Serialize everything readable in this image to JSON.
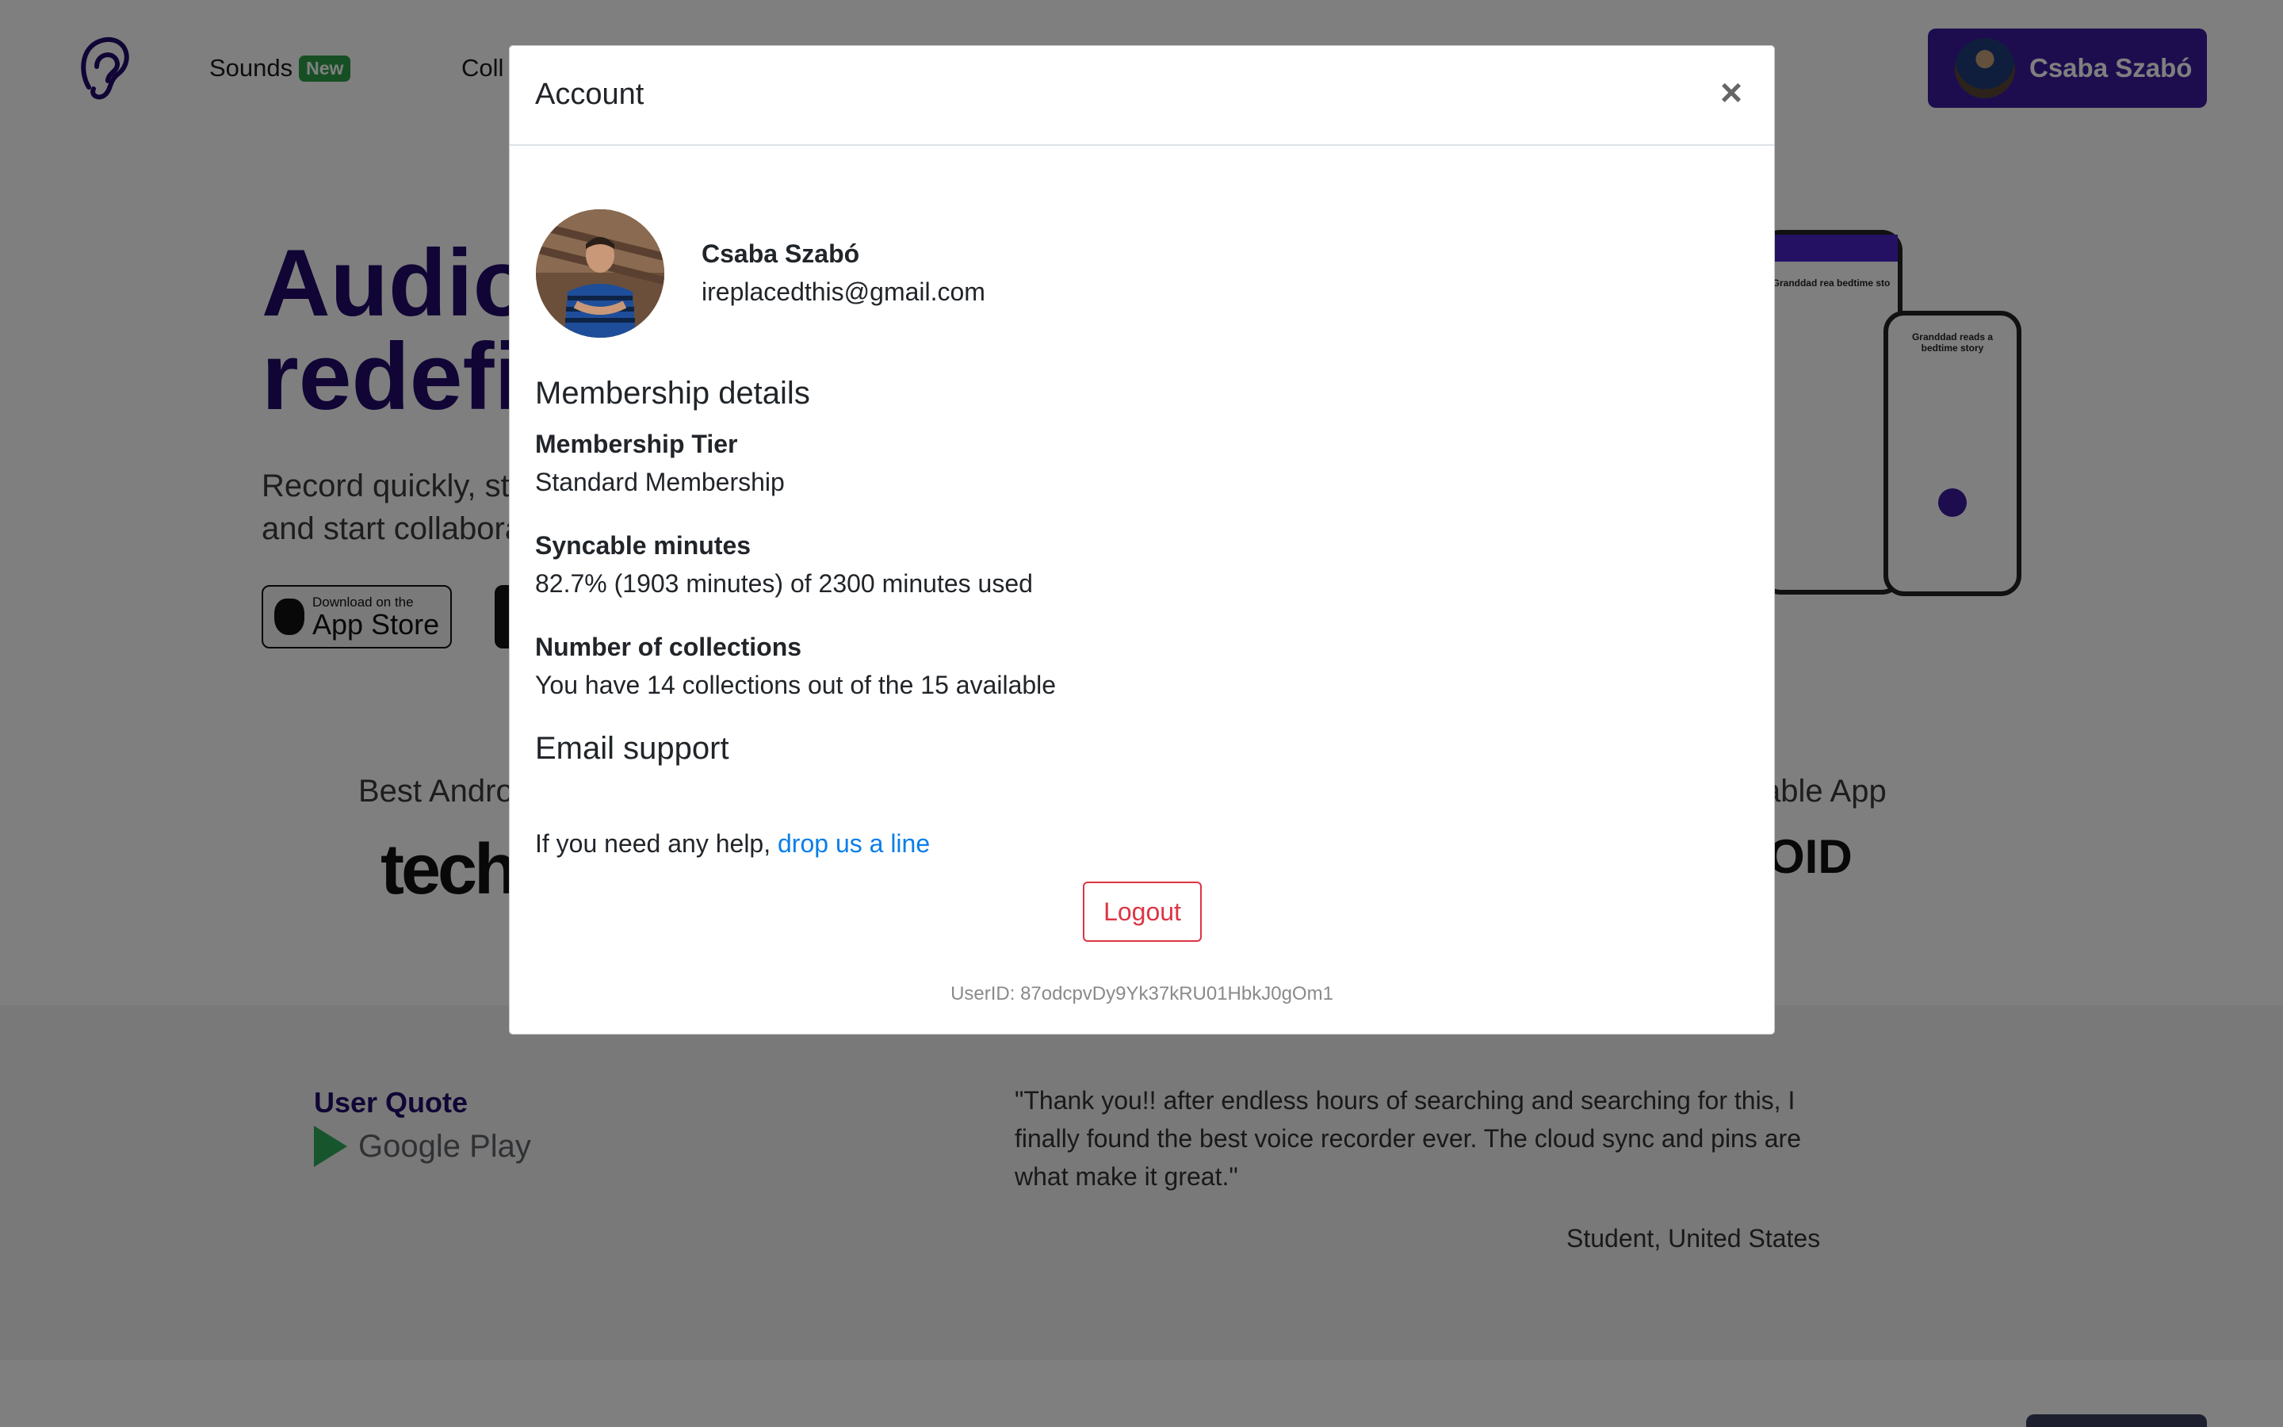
{
  "nav": {
    "links": [
      {
        "label": "Sounds",
        "badge": "New"
      },
      {
        "label": "Coll"
      }
    ],
    "user_name": "Csaba Szabó"
  },
  "hero": {
    "title": "Audio\nredefi",
    "subtitle": "Record quickly, sto\nand start collabora",
    "app_store_small": "Download on the",
    "app_store_big": "App Store"
  },
  "press": {
    "left_text": "Best Andro",
    "right_text": "able App",
    "left_logo": "tech",
    "right_logo": "OID"
  },
  "phones": {
    "tablet_title": "Granddad rea bedtime sto",
    "phone_title": "Granddad reads a bedtime story"
  },
  "testimonial": {
    "heading": "User Quote",
    "store_name": "Google Play",
    "quote": "\"Thank you!! after endless hours of searching and searching for this, I finally found the best voice recorder ever. The cloud sync and pins are what make it great.\"",
    "author": "Student, United States"
  },
  "modal": {
    "title": "Account",
    "close_symbol": "×",
    "profile": {
      "name": "Csaba Szabó",
      "email": "ireplacedthis@gmail.com"
    },
    "membership": {
      "section_title": "Membership details",
      "tier_label": "Membership Tier",
      "tier_value": "Standard Membership",
      "minutes_label": "Syncable minutes",
      "minutes_value": "82.7% (1903 minutes) of 2300 minutes used",
      "collections_label": "Number of collections",
      "collections_value": "You have 14 collections out of the 15 available"
    },
    "support": {
      "section_title": "Email support",
      "help_text": "If you need any help, ",
      "help_link": "drop us a line"
    },
    "logout_label": "Logout",
    "user_id": "UserID: 87odcpvDy9Yk37kRU01HbkJ0gOm1"
  },
  "colors": {
    "brand_purple": "#3a1b9e",
    "hero_title": "#200a6b",
    "link_blue": "#0a7ee8",
    "danger_red": "#dc3545",
    "badge_green": "#2e9e4a",
    "overlay": "rgba(0,0,0,0.5)"
  },
  "icons": [
    "ear-logo-icon",
    "apple-icon",
    "google-play-icon",
    "close-icon"
  ]
}
